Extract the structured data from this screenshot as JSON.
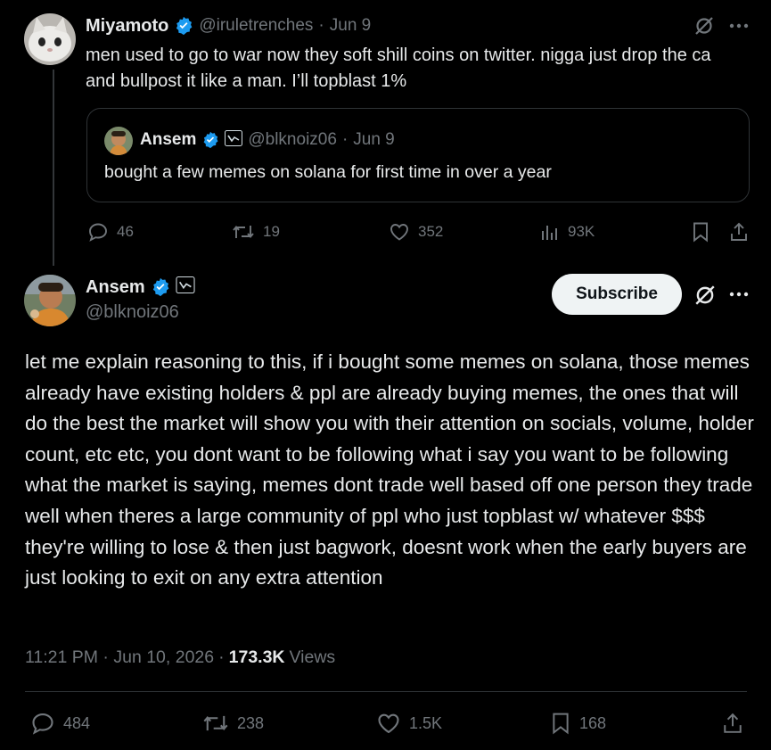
{
  "tweet1": {
    "name": "Miyamoto",
    "handle": "@iruletrenches",
    "date": "Jun 9",
    "text": "men used to go to war now they soft shill coins on twitter. nigga just drop the ca and bullpost it like a man. I’ll topblast 1%",
    "quote": {
      "name": "Ansem",
      "handle": "@blknoiz06",
      "date": "Jun 9",
      "text": "bought a few memes on solana for first time in over a year"
    },
    "stats": {
      "replies": "46",
      "retweets": "19",
      "likes": "352",
      "views": "93K"
    }
  },
  "tweet2": {
    "name": "Ansem",
    "handle": "@blknoiz06",
    "subscribe_label": "Subscribe",
    "text": "let me explain reasoning to this, if i bought some memes on solana, those memes already have existing holders & ppl are already buying memes, the ones that will do the best the market will show you with their attention on socials, volume, holder count, etc etc, you dont want to be following what i say you want to be following what the market is saying, memes dont trade well based off one person they trade well when theres a large community of ppl who just topblast w/ whatever $$$ they're willing to lose & then just bagwork, doesnt work when the early buyers are just looking to exit on any extra attention",
    "timestamp": "11:21 PM · Jun 10, 2026",
    "views_count": "173.3K",
    "views_label": "Views",
    "stats": {
      "replies": "484",
      "retweets": "238",
      "likes": "1.5K",
      "bookmarks": "168"
    }
  },
  "icons": {
    "verified": "verified-badge-icon",
    "affiliate": "affiliate-badge-icon",
    "grok": "grok-icon",
    "more": "more-icon",
    "reply": "reply-icon",
    "retweet": "retweet-icon",
    "like": "like-icon",
    "views": "views-icon",
    "bookmark": "bookmark-icon",
    "share": "share-icon"
  },
  "colors": {
    "accent": "#1d9bf0",
    "muted": "#71767b",
    "text": "#e7e9ea",
    "background": "#000000"
  }
}
